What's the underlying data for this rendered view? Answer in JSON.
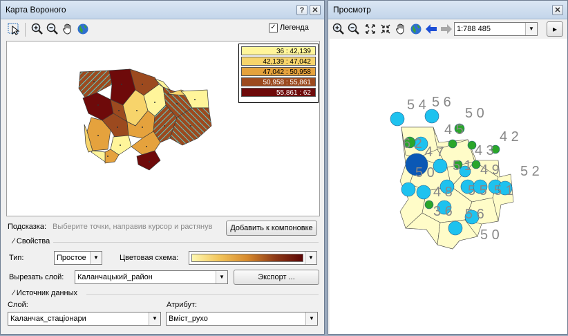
{
  "voronoi_window": {
    "title": "Карта Вороного",
    "help_btn": "?",
    "close_btn": "✕",
    "legend_checkbox_label": "Легенда",
    "legend_checked": "✓",
    "legend": {
      "items": [
        {
          "label": "36 : 42,139",
          "color": "#fff59a"
        },
        {
          "label": "42,139 : 47,042",
          "color": "#f7d46b"
        },
        {
          "label": "47,042 : 50,958",
          "color": "#e5a23d"
        },
        {
          "label": "50,958 : 55,861",
          "color": "#9c4a1f"
        },
        {
          "label": "55,861 : 62",
          "color": "#6e0a0a"
        }
      ]
    },
    "hint_label": "Подсказка:",
    "hint_text": "Выберите точки, направив курсор и растянув",
    "add_to_layout_btn": "Добавить к компоновке",
    "properties_label": "Свойства",
    "type_label": "Тип:",
    "type_value": "Простое",
    "color_scheme_label": "Цветовая схема:",
    "clip_layer_label": "Вырезать слой:",
    "clip_layer_value": "Каланчацький_район",
    "export_btn": "Экспорт ...",
    "data_source_label": "Источник данных",
    "layer_label": "Слой:",
    "layer_value": "Каланчак_стаціонари",
    "attribute_label": "Атрибут:",
    "attribute_value": "Вміст_рухо"
  },
  "preview_window": {
    "title": "Просмотр",
    "close_btn": "✕",
    "scale_value": "1:788 485",
    "go_btn": "▸",
    "map_labels": [
      {
        "text": "5 4"
      },
      {
        "text": "5 6"
      },
      {
        "text": "5 0"
      },
      {
        "text": "4 5"
      },
      {
        "text": "4 2"
      },
      {
        "text": "6 2"
      },
      {
        "text": "4 7"
      },
      {
        "text": "4 3"
      },
      {
        "text": "5 0"
      },
      {
        "text": "5 1"
      },
      {
        "text": "4 9"
      },
      {
        "text": "5 2"
      },
      {
        "text": "4 8"
      },
      {
        "text": "5 5"
      },
      {
        "text": "5 1"
      },
      {
        "text": "3 6"
      },
      {
        "text": "5 6"
      },
      {
        "text": "5 0"
      }
    ]
  },
  "icons": [
    "select-arrow-icon",
    "zoom-in-icon",
    "zoom-out-icon",
    "pan-hand-icon",
    "globe-icon",
    "zoom-in-fixed-icon",
    "zoom-out-fixed-icon",
    "back-arrow-icon",
    "forward-arrow-icon"
  ]
}
